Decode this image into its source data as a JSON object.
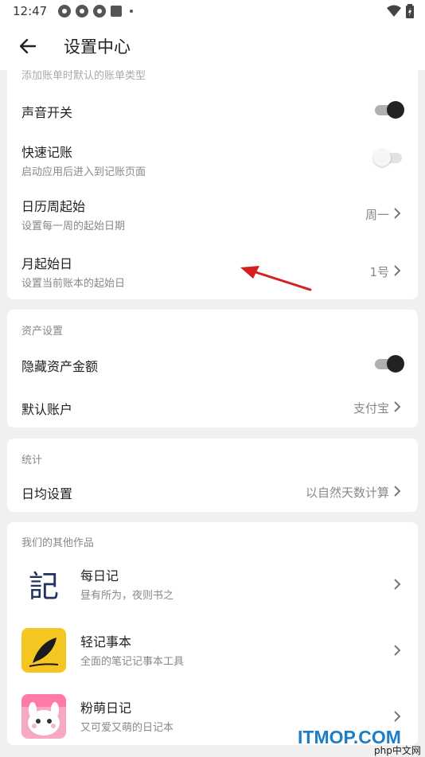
{
  "status": {
    "time": "12:47"
  },
  "header": {
    "title": "设置中心"
  },
  "general": {
    "partial_text": "添加账单时默认的账单类型",
    "items": [
      {
        "title": "声音开关",
        "toggle": "on"
      },
      {
        "title": "快速记账",
        "subtitle": "启动应用后进入到记账页面",
        "toggle": "off"
      },
      {
        "title": "日历周起始",
        "subtitle": "设置每一周的起始日期",
        "value": "周一"
      },
      {
        "title": "月起始日",
        "subtitle": "设置当前账本的起始日",
        "value": "1号"
      }
    ]
  },
  "assets": {
    "label": "资产设置",
    "items": [
      {
        "title": "隐藏资产金额",
        "toggle": "on"
      },
      {
        "title": "默认账户",
        "value": "支付宝"
      }
    ]
  },
  "stats": {
    "label": "统计",
    "items": [
      {
        "title": "日均设置",
        "value": "以自然天数计算"
      }
    ]
  },
  "works": {
    "label": "我们的其他作品",
    "apps": [
      {
        "title": "每日记",
        "subtitle": "昼有所为，夜则书之",
        "icon": "meiriji-logo"
      },
      {
        "title": "轻记事本",
        "subtitle": "全面的笔记记事本工具",
        "icon": "feather-icon"
      },
      {
        "title": "粉萌日记",
        "subtitle": "又可爱又萌的日记本",
        "icon": "cute-bunny-icon"
      }
    ]
  },
  "watermark": {
    "main": "ITMOP.COM",
    "sub": "php中文网"
  },
  "colors": {
    "annotation_arrow": "#d42020",
    "toggle_on": "#222222",
    "feather_bg": "#f5c521"
  }
}
